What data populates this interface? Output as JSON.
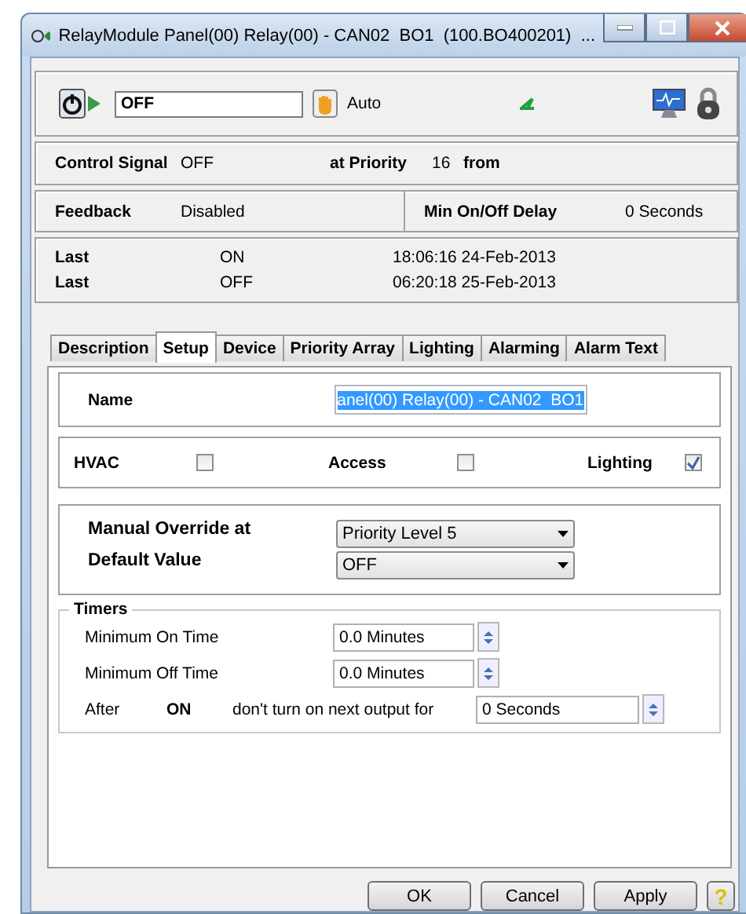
{
  "window": {
    "title": "RelayModule Panel(00) Relay(00) - CAN02  BO1  (100.BO400201)  ..."
  },
  "header": {
    "value": "OFF",
    "mode": "Auto"
  },
  "control_signal": {
    "label": "Control Signal",
    "value": "OFF",
    "priority_label": "at Priority",
    "priority": "16",
    "from_label": "from"
  },
  "feedback": {
    "label": "Feedback",
    "value": "Disabled",
    "delay_label": "Min On/Off Delay",
    "delay": "0 Seconds"
  },
  "history": [
    {
      "label": "Last",
      "state": "ON",
      "time": "18:06:16 24-Feb-2013"
    },
    {
      "label": "Last",
      "state": "OFF",
      "time": "06:20:18 25-Feb-2013"
    }
  ],
  "tabs": [
    {
      "label": "Description",
      "selected": false
    },
    {
      "label": "Setup",
      "selected": true
    },
    {
      "label": "Device",
      "selected": false
    },
    {
      "label": "Priority Array",
      "selected": false
    },
    {
      "label": "Lighting",
      "selected": false
    },
    {
      "label": "Alarming",
      "selected": false
    },
    {
      "label": "Alarm Text",
      "selected": false
    }
  ],
  "setup": {
    "name_label": "Name",
    "name_value": "anel(00) Relay(00) - CAN02  BO1",
    "name_text_selected": true,
    "categories": [
      {
        "label": "HVAC",
        "checked": false
      },
      {
        "label": "Access",
        "checked": false
      },
      {
        "label": "Lighting",
        "checked": true
      }
    ],
    "dropdowns": [
      {
        "label": "Manual Override at",
        "value": "Priority Level 5"
      },
      {
        "label": "Default Value",
        "value": "OFF"
      }
    ],
    "timers": {
      "title": "Timers",
      "rows": [
        {
          "label": "Minimum On Time",
          "value": "0.0 Minutes"
        },
        {
          "label": "Minimum Off Time",
          "value": "0.0 Minutes"
        }
      ],
      "after": {
        "label": "After",
        "state": "ON",
        "text": "don't turn on next output for",
        "value": "0 Seconds"
      }
    }
  },
  "buttons": [
    {
      "label": "OK"
    },
    {
      "label": "Cancel"
    },
    {
      "label": "Apply"
    }
  ],
  "help": "?"
}
